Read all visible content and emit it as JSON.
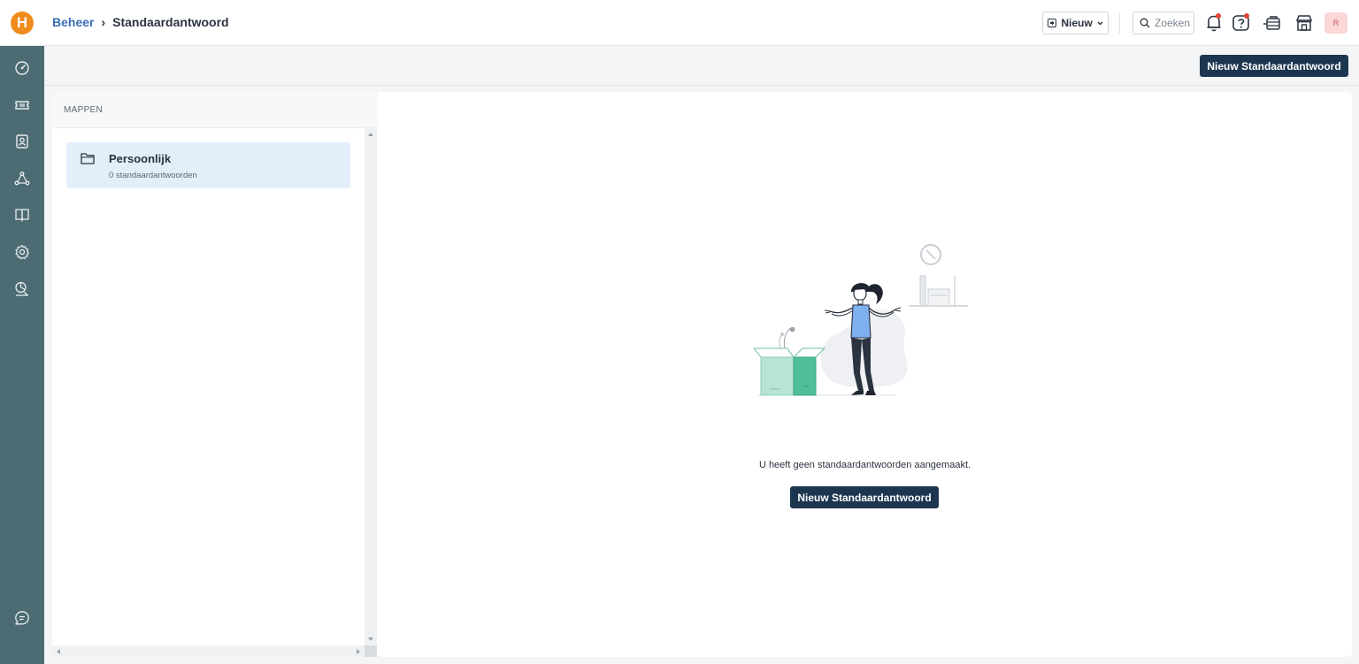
{
  "app": {
    "logo_letter": "H"
  },
  "breadcrumb": {
    "parent": "Beheer",
    "separator": "›",
    "current": "Standaardantwoord"
  },
  "header": {
    "new_label": "Nieuw",
    "search_placeholder": "Zoeken",
    "avatar_initial": "R"
  },
  "sidebar": {
    "items": [
      {
        "icon": "dashboard-icon"
      },
      {
        "icon": "ticket-icon"
      },
      {
        "icon": "contacts-icon"
      },
      {
        "icon": "workflow-icon"
      },
      {
        "icon": "knowledge-base-icon"
      },
      {
        "icon": "settings-icon"
      },
      {
        "icon": "reports-icon"
      }
    ],
    "bottom_icon": "feedback-icon"
  },
  "actions": {
    "primary_label": "Nieuw Standaardantwoord"
  },
  "folders": {
    "heading": "MAPPEN",
    "items": [
      {
        "name": "Persoonlijk",
        "count_text": "0 standaardantwoorden"
      }
    ]
  },
  "empty_state": {
    "message": "U heeft geen standaardantwoorden aangemaakt.",
    "button_label": "Nieuw Standaardantwoord"
  },
  "colors": {
    "brand_orange": "#f08c1c",
    "sidebar": "#4d6b73",
    "primary_button": "#1d3650",
    "link": "#3b6fb6",
    "selected_folder": "#e3eefb",
    "notification_dot": "#e2453d"
  }
}
